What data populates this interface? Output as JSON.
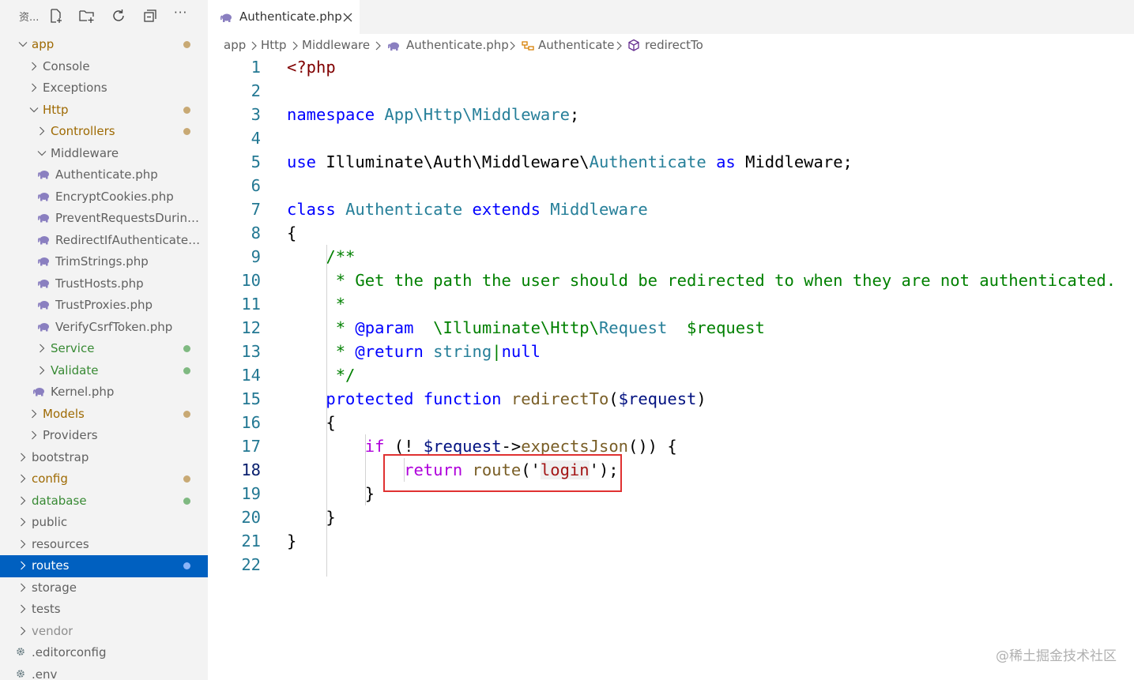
{
  "explorer": {
    "title": "资...",
    "toolbar": [
      {
        "name": "new-file-icon"
      },
      {
        "name": "new-folder-icon"
      },
      {
        "name": "refresh-icon"
      },
      {
        "name": "collapse-all-icon"
      },
      {
        "name": "more-icon",
        "label": "···"
      }
    ],
    "items": [
      {
        "label": "app",
        "depth": 0,
        "kind": "folder",
        "open": true,
        "status": "modified"
      },
      {
        "label": "Console",
        "depth": 1,
        "kind": "folder",
        "open": false,
        "status": "none"
      },
      {
        "label": "Exceptions",
        "depth": 1,
        "kind": "folder",
        "open": false,
        "status": "none"
      },
      {
        "label": "Http",
        "depth": 1,
        "kind": "folder",
        "open": true,
        "status": "modified"
      },
      {
        "label": "Controllers",
        "depth": 2,
        "kind": "folder",
        "open": false,
        "status": "modified"
      },
      {
        "label": "Middleware",
        "depth": 2,
        "kind": "folder",
        "open": true,
        "status": "none"
      },
      {
        "label": "Authenticate.php",
        "depth": 3,
        "kind": "php",
        "status": "none"
      },
      {
        "label": "EncryptCookies.php",
        "depth": 3,
        "kind": "php",
        "status": "none"
      },
      {
        "label": "PreventRequestsDuring...",
        "depth": 3,
        "kind": "php",
        "status": "none"
      },
      {
        "label": "RedirectIfAuthenticated....",
        "depth": 3,
        "kind": "php",
        "status": "none"
      },
      {
        "label": "TrimStrings.php",
        "depth": 3,
        "kind": "php",
        "status": "none"
      },
      {
        "label": "TrustHosts.php",
        "depth": 3,
        "kind": "php",
        "status": "none"
      },
      {
        "label": "TrustProxies.php",
        "depth": 3,
        "kind": "php",
        "status": "none"
      },
      {
        "label": "VerifyCsrfToken.php",
        "depth": 3,
        "kind": "php",
        "status": "none"
      },
      {
        "label": "Service",
        "depth": 2,
        "kind": "folder",
        "open": false,
        "status": "added"
      },
      {
        "label": "Validate",
        "depth": 2,
        "kind": "folder",
        "open": false,
        "status": "added"
      },
      {
        "label": "Kernel.php",
        "depth": 2,
        "kind": "php",
        "status": "none"
      },
      {
        "label": "Models",
        "depth": 1,
        "kind": "folder",
        "open": false,
        "status": "modified"
      },
      {
        "label": "Providers",
        "depth": 1,
        "kind": "folder",
        "open": false,
        "status": "none"
      },
      {
        "label": "bootstrap",
        "depth": 0,
        "kind": "folder",
        "open": false,
        "status": "none"
      },
      {
        "label": "config",
        "depth": 0,
        "kind": "folder",
        "open": false,
        "status": "modified"
      },
      {
        "label": "database",
        "depth": 0,
        "kind": "folder",
        "open": false,
        "status": "added"
      },
      {
        "label": "public",
        "depth": 0,
        "kind": "folder",
        "open": false,
        "status": "none"
      },
      {
        "label": "resources",
        "depth": 0,
        "kind": "folder",
        "open": false,
        "status": "none"
      },
      {
        "label": "routes",
        "depth": 0,
        "kind": "folder",
        "open": false,
        "status": "selected"
      },
      {
        "label": "storage",
        "depth": 0,
        "kind": "folder",
        "open": false,
        "status": "none"
      },
      {
        "label": "tests",
        "depth": 0,
        "kind": "folder",
        "open": false,
        "status": "none"
      },
      {
        "label": "vendor",
        "depth": 0,
        "kind": "folder",
        "open": false,
        "status": "ignored"
      },
      {
        "label": ".editorconfig",
        "depth": 0,
        "kind": "gear",
        "status": "none"
      },
      {
        "label": ".env",
        "depth": 0,
        "kind": "gear",
        "status": "none"
      }
    ],
    "colors": {
      "modified": "#c8a974",
      "added": "#7fb981",
      "selected_dot": "#8ab4f8",
      "selected_bg": "#0060c0",
      "folder_modified_text": "#9e6a03",
      "folder_added_text": "#388a34"
    }
  },
  "tab": {
    "label": "Authenticate.php",
    "icon": "php-elephant-icon"
  },
  "breadcrumb": [
    "app",
    "Http",
    "Middleware",
    "Authenticate.php",
    "Authenticate",
    "redirectTo"
  ],
  "code": {
    "current_line": 18,
    "lines": [
      [
        {
          "t": "<?php",
          "c": "tag"
        }
      ],
      [],
      [
        {
          "t": "namespace ",
          "c": "kw"
        },
        {
          "t": "App\\Http\\Middleware",
          "c": "cls"
        },
        {
          "t": ";",
          "c": ""
        }
      ],
      [],
      [
        {
          "t": "use ",
          "c": "kw"
        },
        {
          "t": "Illuminate\\Auth\\Middleware\\",
          "c": ""
        },
        {
          "t": "Authenticate",
          "c": "cls"
        },
        {
          "t": " as ",
          "c": "kw"
        },
        {
          "t": "Middleware;",
          "c": ""
        }
      ],
      [],
      [
        {
          "t": "class ",
          "c": "kw"
        },
        {
          "t": "Authenticate",
          "c": "cls"
        },
        {
          "t": " extends ",
          "c": "kw"
        },
        {
          "t": "Middleware",
          "c": "cls"
        }
      ],
      [
        {
          "t": "{",
          "c": ""
        }
      ],
      [
        {
          "t": "    /**",
          "c": "cm"
        }
      ],
      [
        {
          "t": "     * Get the path the user should be redirected to when they are not authenticated.",
          "c": "cm"
        }
      ],
      [
        {
          "t": "     *",
          "c": "cm"
        }
      ],
      [
        {
          "t": "     * ",
          "c": "cm"
        },
        {
          "t": "@param",
          "c": "kw"
        },
        {
          "t": "  \\Illuminate\\Http\\",
          "c": "cm"
        },
        {
          "t": "Request",
          "c": "cls"
        },
        {
          "t": "  $request",
          "c": "cm"
        }
      ],
      [
        {
          "t": "     * ",
          "c": "cm"
        },
        {
          "t": "@return",
          "c": "kw"
        },
        {
          "t": " string",
          "c": "cls"
        },
        {
          "t": "|",
          "c": "cm"
        },
        {
          "t": "null",
          "c": "kw"
        }
      ],
      [
        {
          "t": "     */",
          "c": "cm"
        }
      ],
      [
        {
          "t": "    protected function ",
          "c": "kw"
        },
        {
          "t": "redirectTo",
          "c": "fn"
        },
        {
          "t": "(",
          "c": ""
        },
        {
          "t": "$request",
          "c": "var"
        },
        {
          "t": ")",
          "c": ""
        }
      ],
      [
        {
          "t": "    {",
          "c": ""
        }
      ],
      [
        {
          "t": "        if",
          "c": "pc"
        },
        {
          "t": " (! ",
          "c": ""
        },
        {
          "t": "$request",
          "c": "var"
        },
        {
          "t": "->",
          "c": ""
        },
        {
          "t": "expectsJson",
          "c": "fn"
        },
        {
          "t": "()) {",
          "c": ""
        }
      ],
      [
        {
          "t": "            return ",
          "c": "pc"
        },
        {
          "t": "route",
          "c": "fn"
        },
        {
          "t": "('",
          "c": ""
        },
        {
          "t": "login",
          "c": "strhl"
        },
        {
          "t": "');",
          "c": ""
        }
      ],
      [
        {
          "t": "        }",
          "c": ""
        }
      ],
      [
        {
          "t": "    }",
          "c": ""
        }
      ],
      [
        {
          "t": "}",
          "c": ""
        }
      ],
      []
    ]
  },
  "watermark": "@稀土掘金技术社区"
}
